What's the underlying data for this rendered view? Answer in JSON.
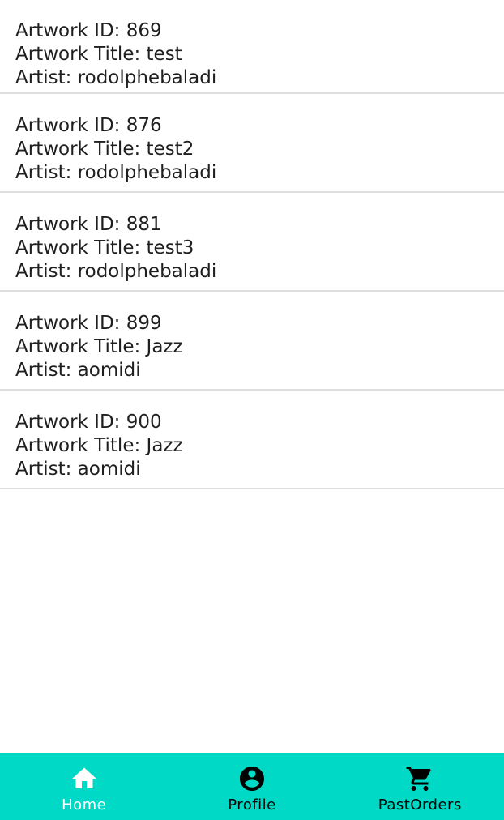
{
  "artworks": [
    {
      "id_label": "Artwork ID: ",
      "id": "869",
      "title_label": "Artwork Title: ",
      "title": "test",
      "artist_label": "Artist: ",
      "artist": "rodolphebaladi"
    },
    {
      "id_label": "Artwork ID: ",
      "id": "876",
      "title_label": "Artwork Title: ",
      "title": "test2",
      "artist_label": "Artist: ",
      "artist": "rodolphebaladi"
    },
    {
      "id_label": "Artwork ID: ",
      "id": "881",
      "title_label": "Artwork Title: ",
      "title": "test3",
      "artist_label": "Artist: ",
      "artist": "rodolphebaladi"
    },
    {
      "id_label": "Artwork ID: ",
      "id": "899",
      "title_label": "Artwork Title: ",
      "title": "Jazz",
      "artist_label": "Artist: ",
      "artist": "aomidi"
    },
    {
      "id_label": "Artwork ID: ",
      "id": "900",
      "title_label": "Artwork Title: ",
      "title": "Jazz",
      "artist_label": "Artist: ",
      "artist": "aomidi"
    }
  ],
  "bottom_nav": {
    "background": "#00d9c5",
    "active_color": "#ffffff",
    "inactive_color": "#000000",
    "items": [
      {
        "label": "Home",
        "icon": "home-icon",
        "active": true
      },
      {
        "label": "Profile",
        "icon": "account-circle-icon",
        "active": false
      },
      {
        "label": "PastOrders",
        "icon": "shopping-cart-icon",
        "active": false
      }
    ]
  }
}
